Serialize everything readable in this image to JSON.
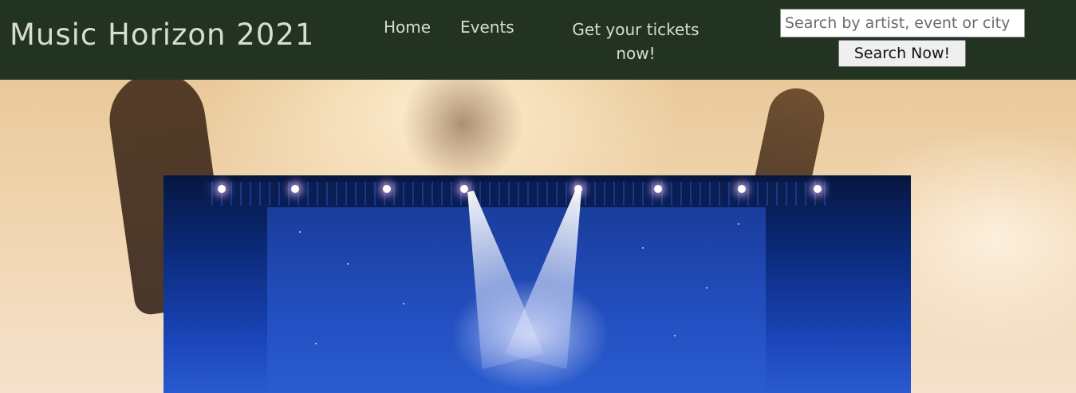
{
  "header": {
    "brand": "Music Horizon 2021",
    "nav": {
      "home": "Home",
      "events": "Events",
      "tickets": "Get your tickets now!"
    },
    "search": {
      "placeholder": "Search by artist, event or city",
      "button_label": "Search Now!"
    }
  },
  "colors": {
    "header_bg": "#233322",
    "header_text": "#d7dcd5",
    "stage_blue": "#1a45b8"
  },
  "images": {
    "hero": "concert crowd with raised hands",
    "stage": "stage with spotlights"
  }
}
